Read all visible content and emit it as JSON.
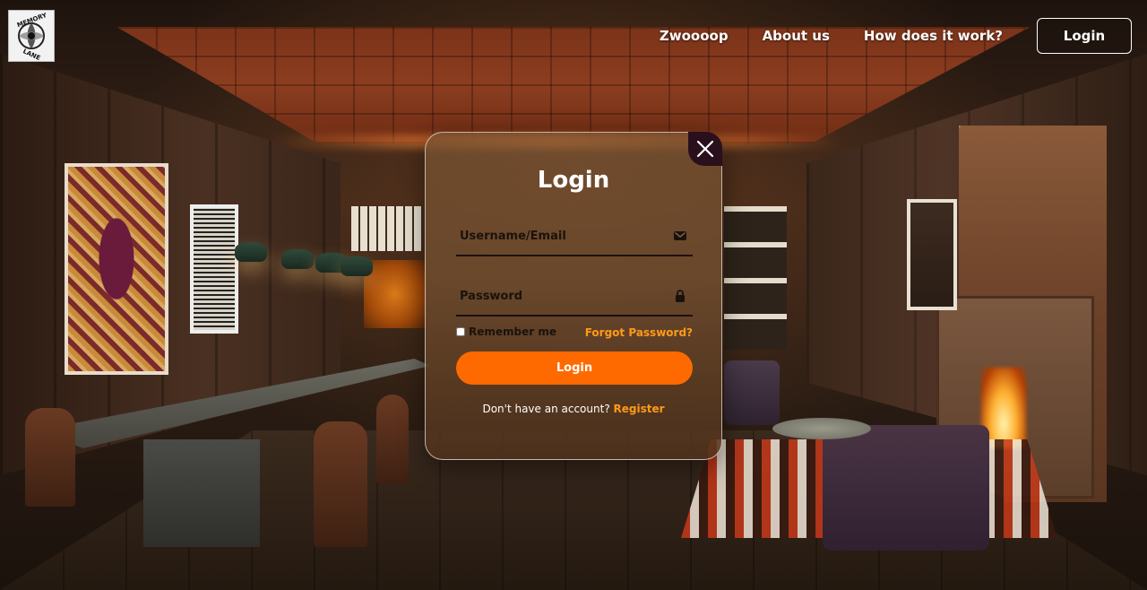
{
  "header": {
    "logo_text": "MEMORY LANE",
    "nav": [
      {
        "label": "Zwoooop"
      },
      {
        "label": "About us"
      },
      {
        "label": "How does it work?"
      }
    ],
    "login_button": "Login"
  },
  "modal": {
    "title": "Login",
    "username": {
      "placeholder": "Username/Email",
      "value": "",
      "icon": "envelope-icon"
    },
    "password": {
      "placeholder": "Password",
      "value": "",
      "icon": "lock-icon"
    },
    "remember_label": "Remember me",
    "remember_checked": false,
    "forgot_link": "Forgot Password?",
    "login_button": "Login",
    "register_prompt": "Don't have an account?",
    "register_link": "Register",
    "close_icon": "close-icon"
  },
  "colors": {
    "accent": "#ff6a00",
    "link": "#ff9a1a",
    "close_bg": "#2a0f1c",
    "text_dark": "#1a120c"
  }
}
